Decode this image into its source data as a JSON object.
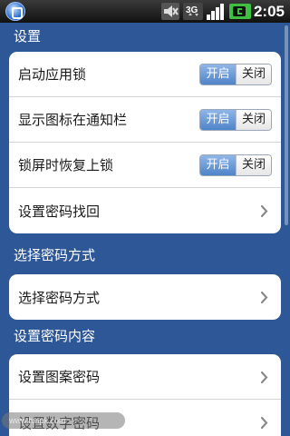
{
  "status_bar": {
    "time": "2:05",
    "network_label": "3G",
    "icons": [
      "app-lock-icon",
      "mute-icon",
      "network-3g-icon",
      "signal-icon",
      "battery-charging-icon"
    ]
  },
  "colors": {
    "background": "#2d5796",
    "toggle_on": "#4f84c9",
    "battery_green": "#3fbf3f"
  },
  "sections": [
    {
      "title": "设置",
      "rows": [
        {
          "label": "启动应用锁",
          "toggle": {
            "on_label": "开启",
            "off_label": "关闭",
            "state": "on"
          }
        },
        {
          "label": "显示图标在通知栏",
          "toggle": {
            "on_label": "开启",
            "off_label": "关闭",
            "state": "on"
          }
        },
        {
          "label": "锁屏时恢复上锁",
          "toggle": {
            "on_label": "开启",
            "off_label": "关闭",
            "state": "on"
          }
        },
        {
          "label": "设置密码找回",
          "chevron": "chevron-right-icon"
        }
      ]
    },
    {
      "title": "选择密码方式",
      "rows": [
        {
          "label": "选择密码方式",
          "chevron": "chevron-right-icon"
        }
      ]
    },
    {
      "title": "设置密码内容",
      "rows": [
        {
          "label": "设置图案密码",
          "chevron": "chevron-right-icon"
        },
        {
          "label": "设置数字密码",
          "chevron": "chevron-right-icon"
        }
      ]
    }
  ],
  "watermark": "www.hiapk.com"
}
